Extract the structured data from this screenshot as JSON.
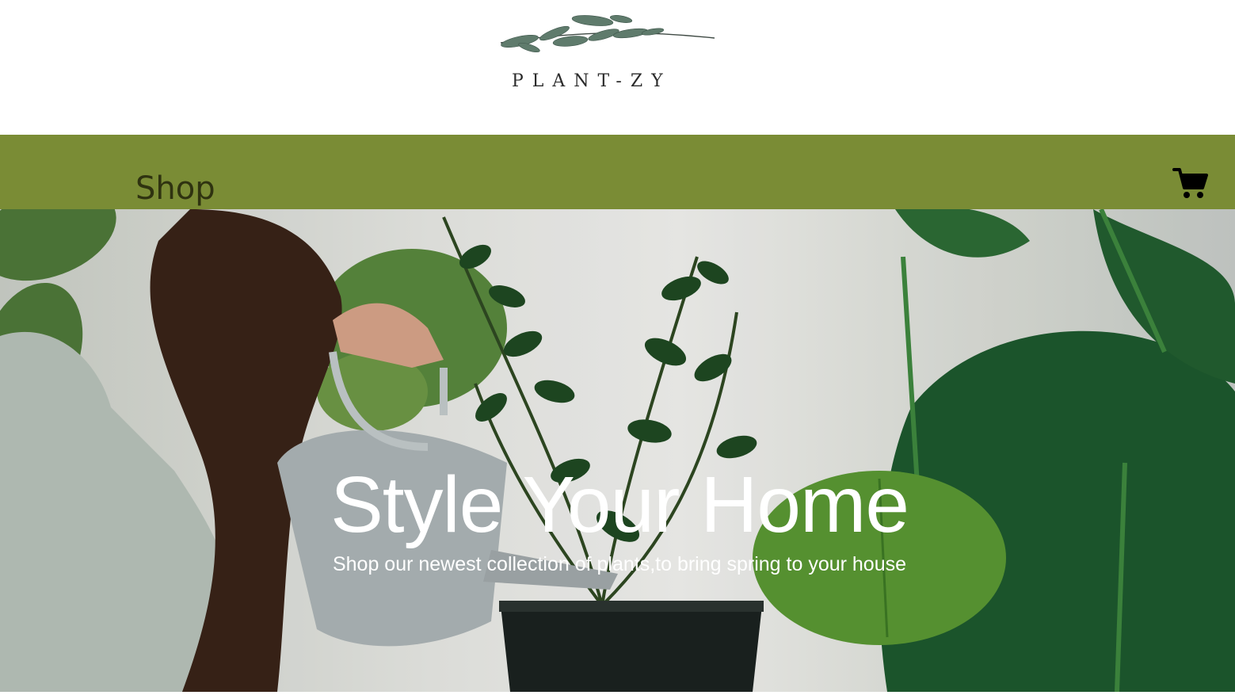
{
  "brand": {
    "name": "PLANT-ZY",
    "logo_icon": "leaf-branch-icon"
  },
  "nav": {
    "items": [
      {
        "label": "Shop"
      }
    ],
    "cart_icon": "cart-icon"
  },
  "hero": {
    "title": "Style Your Home",
    "subtitle": "Shop our newest collection of plants,to bring spring to your house",
    "image": "woman-watering-plants-photo"
  },
  "colors": {
    "nav_background": "#7a8c35",
    "nav_text": "#2f3310",
    "hero_text": "#ffffff"
  }
}
